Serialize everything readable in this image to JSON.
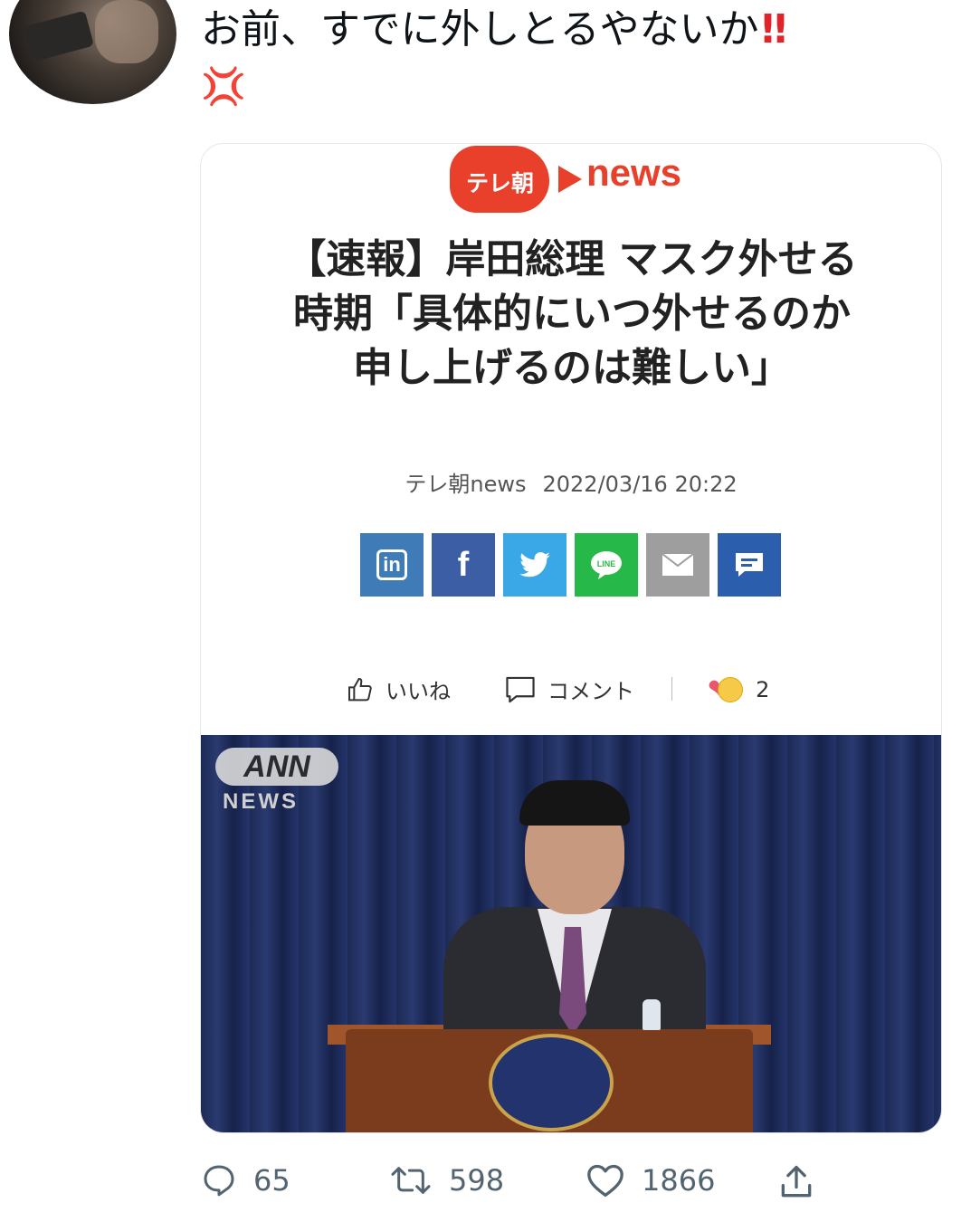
{
  "tweet": {
    "text": "お前、すでに外しとるやないか",
    "emoji_bang": "!!",
    "emoji_anger": "💢"
  },
  "card": {
    "logo_left": "テレ朝",
    "logo_right": "news",
    "headline": [
      "【速報】岸田総理 マスク外せる",
      "時期「具体的にいつ外せるのか",
      "申し上げるのは難しい」"
    ],
    "source": "テレ朝news",
    "datetime": "2022/03/16 20:22",
    "share_buttons": [
      "in",
      "f",
      "twitter",
      "LINE",
      "mail",
      "comment"
    ],
    "like_label": "いいね",
    "comment_label": "コメント",
    "reaction_count": "2",
    "photo": {
      "badge": "ANN",
      "badge_sub": "NEWS"
    }
  },
  "actions": {
    "replies": "65",
    "retweets": "598",
    "likes": "1866"
  },
  "colors": {
    "brand_red": "#e8402a",
    "linkedin": "#3f7bb6",
    "facebook": "#3b5ea5",
    "twitter": "#3aa8e7",
    "line": "#27b84a",
    "mail": "#9e9e9e",
    "comment": "#2b5fad"
  }
}
